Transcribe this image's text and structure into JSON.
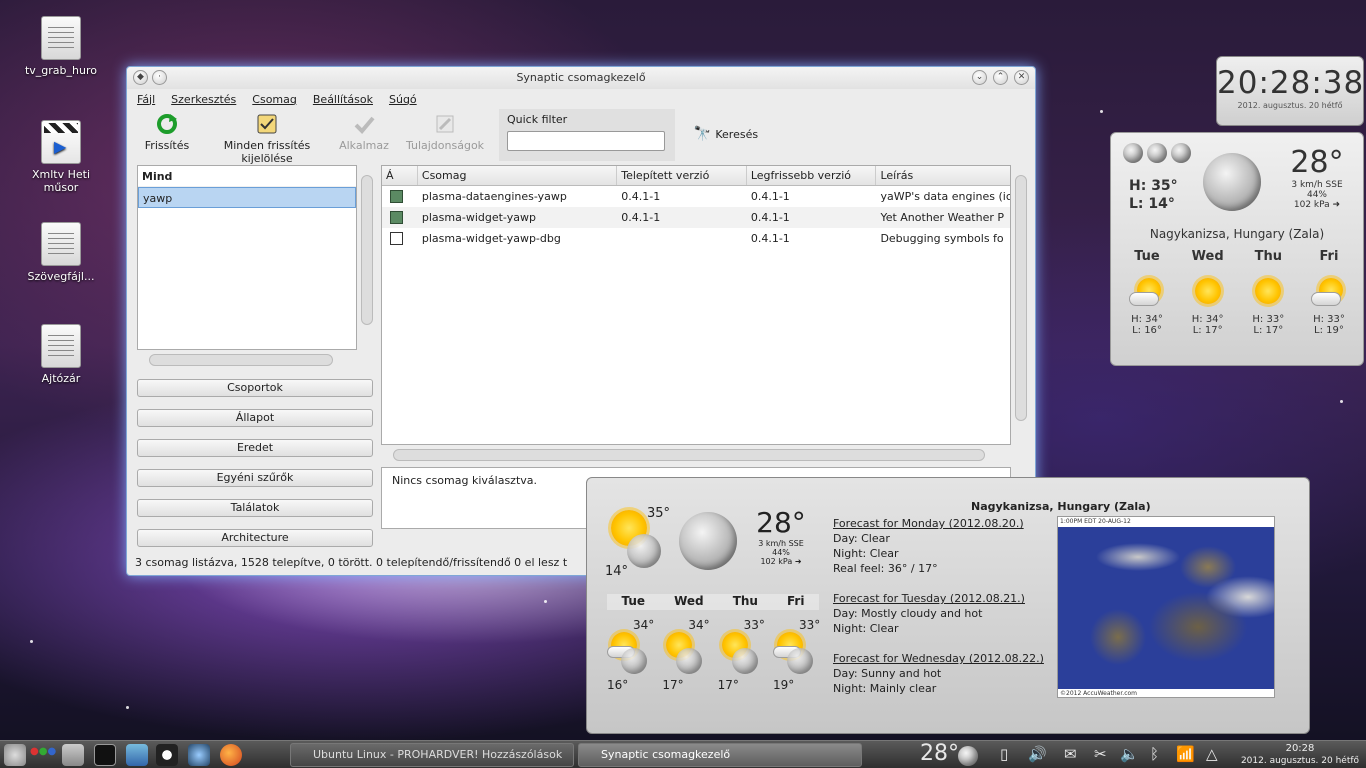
{
  "desktop": {
    "icons": [
      {
        "label": "tv_grab_huro"
      },
      {
        "label": "Xmltv Heti műsor"
      },
      {
        "label": "Szövegfájl..."
      },
      {
        "label": "Ajtózár"
      }
    ]
  },
  "window": {
    "title": "Synaptic csomagkezelő",
    "menu": [
      "Fájl",
      "Szerkesztés",
      "Csomag",
      "Beállítások",
      "Súgó"
    ],
    "toolbar": {
      "reload": "Frissítés",
      "mark_all": "Minden frissítés kijelölése",
      "apply": "Alkalmaz",
      "properties": "Tulajdonságok",
      "quick_filter_label": "Quick filter",
      "quick_filter_value": "",
      "search": "Keresés"
    },
    "filters": {
      "header": "Mind",
      "items": [
        "yawp"
      ],
      "selected": "yawp"
    },
    "side_buttons": [
      "Csoportok",
      "Állapot",
      "Eredet",
      "Egyéni szűrők",
      "Találatok",
      "Architecture"
    ],
    "table": {
      "columns": [
        "Á",
        "Csomag",
        "Telepített verzió",
        "Legfrissebb verzió",
        "Leírás"
      ],
      "rows": [
        {
          "checked": true,
          "name": "plasma-dataengines-yawp",
          "installed": "0.4.1-1",
          "latest": "0.4.1-1",
          "desc": "yaWP's data engines (ic"
        },
        {
          "checked": true,
          "name": "plasma-widget-yawp",
          "installed": "0.4.1-1",
          "latest": "0.4.1-1",
          "desc": "Yet Another Weather P"
        },
        {
          "checked": false,
          "name": "plasma-widget-yawp-dbg",
          "installed": "",
          "latest": "0.4.1-1",
          "desc": "Debugging symbols fo"
        }
      ]
    },
    "description": "Nincs csomag kiválasztva.",
    "status": "3 csomag listázva, 1528 telepítve, 0 törött. 0 telepítendő/frissítendő 0 el lesz t"
  },
  "clock": {
    "time": "20:28:38",
    "date": "2012. augusztus. 20 hétfő"
  },
  "weather_small": {
    "temp": "28°",
    "wind": "3 km/h SSE",
    "humidity": "44%",
    "pressure": "102 kPa ➜",
    "high": "H: 35°",
    "low": "L: 14°",
    "location": "Nagykanizsa, Hungary (Zala)",
    "days": [
      {
        "day": "Tue",
        "high": "H: 34°",
        "low": "L: 16°",
        "icon": "partly-cloudy-icon"
      },
      {
        "day": "Wed",
        "high": "H: 34°",
        "low": "L: 17°",
        "icon": "sunny-icon"
      },
      {
        "day": "Thu",
        "high": "H: 33°",
        "low": "L: 17°",
        "icon": "sunny-icon"
      },
      {
        "day": "Fri",
        "high": "H: 33°",
        "low": "L: 19°",
        "icon": "partly-cloudy-icon"
      }
    ]
  },
  "weather_big": {
    "location": "Nagykanizsa, Hungary (Zala)",
    "high": "35°",
    "low": "14°",
    "temp": "28°",
    "wind": "3 km/h SSE",
    "humidity": "44%",
    "pressure": "102 kPa ➜",
    "days": [
      {
        "day": "Tue",
        "high": "34°",
        "low": "16°"
      },
      {
        "day": "Wed",
        "high": "34°",
        "low": "17°"
      },
      {
        "day": "Thu",
        "high": "33°",
        "low": "17°"
      },
      {
        "day": "Fri",
        "high": "33°",
        "low": "19°"
      }
    ],
    "forecasts": [
      {
        "title": "Forecast for Monday (2012.08.20.)",
        "lines": [
          "Day: Clear",
          "Night: Clear",
          "Real feel: 36° / 17°"
        ]
      },
      {
        "title": "Forecast for Tuesday (2012.08.21.)",
        "lines": [
          "Day: Mostly cloudy and hot",
          "Night: Clear"
        ]
      },
      {
        "title": "Forecast for Wednesday (2012.08.22.)",
        "lines": [
          "Day: Sunny and hot",
          "Night: Mainly clear"
        ]
      }
    ],
    "map_caption_top": "1:00PM EDT 20-AUG-12",
    "map_caption_bottom": "©2012 AccuWeather.com"
  },
  "taskbar": {
    "tasks": [
      {
        "label": "Ubuntu Linux - PROHARDVER! Hozzászólások",
        "active": false
      },
      {
        "label": "Synaptic csomagkezelő",
        "active": true
      }
    ],
    "temp": "28°",
    "time": "20:28",
    "date": "2012. augusztus. 20 hétfő"
  }
}
